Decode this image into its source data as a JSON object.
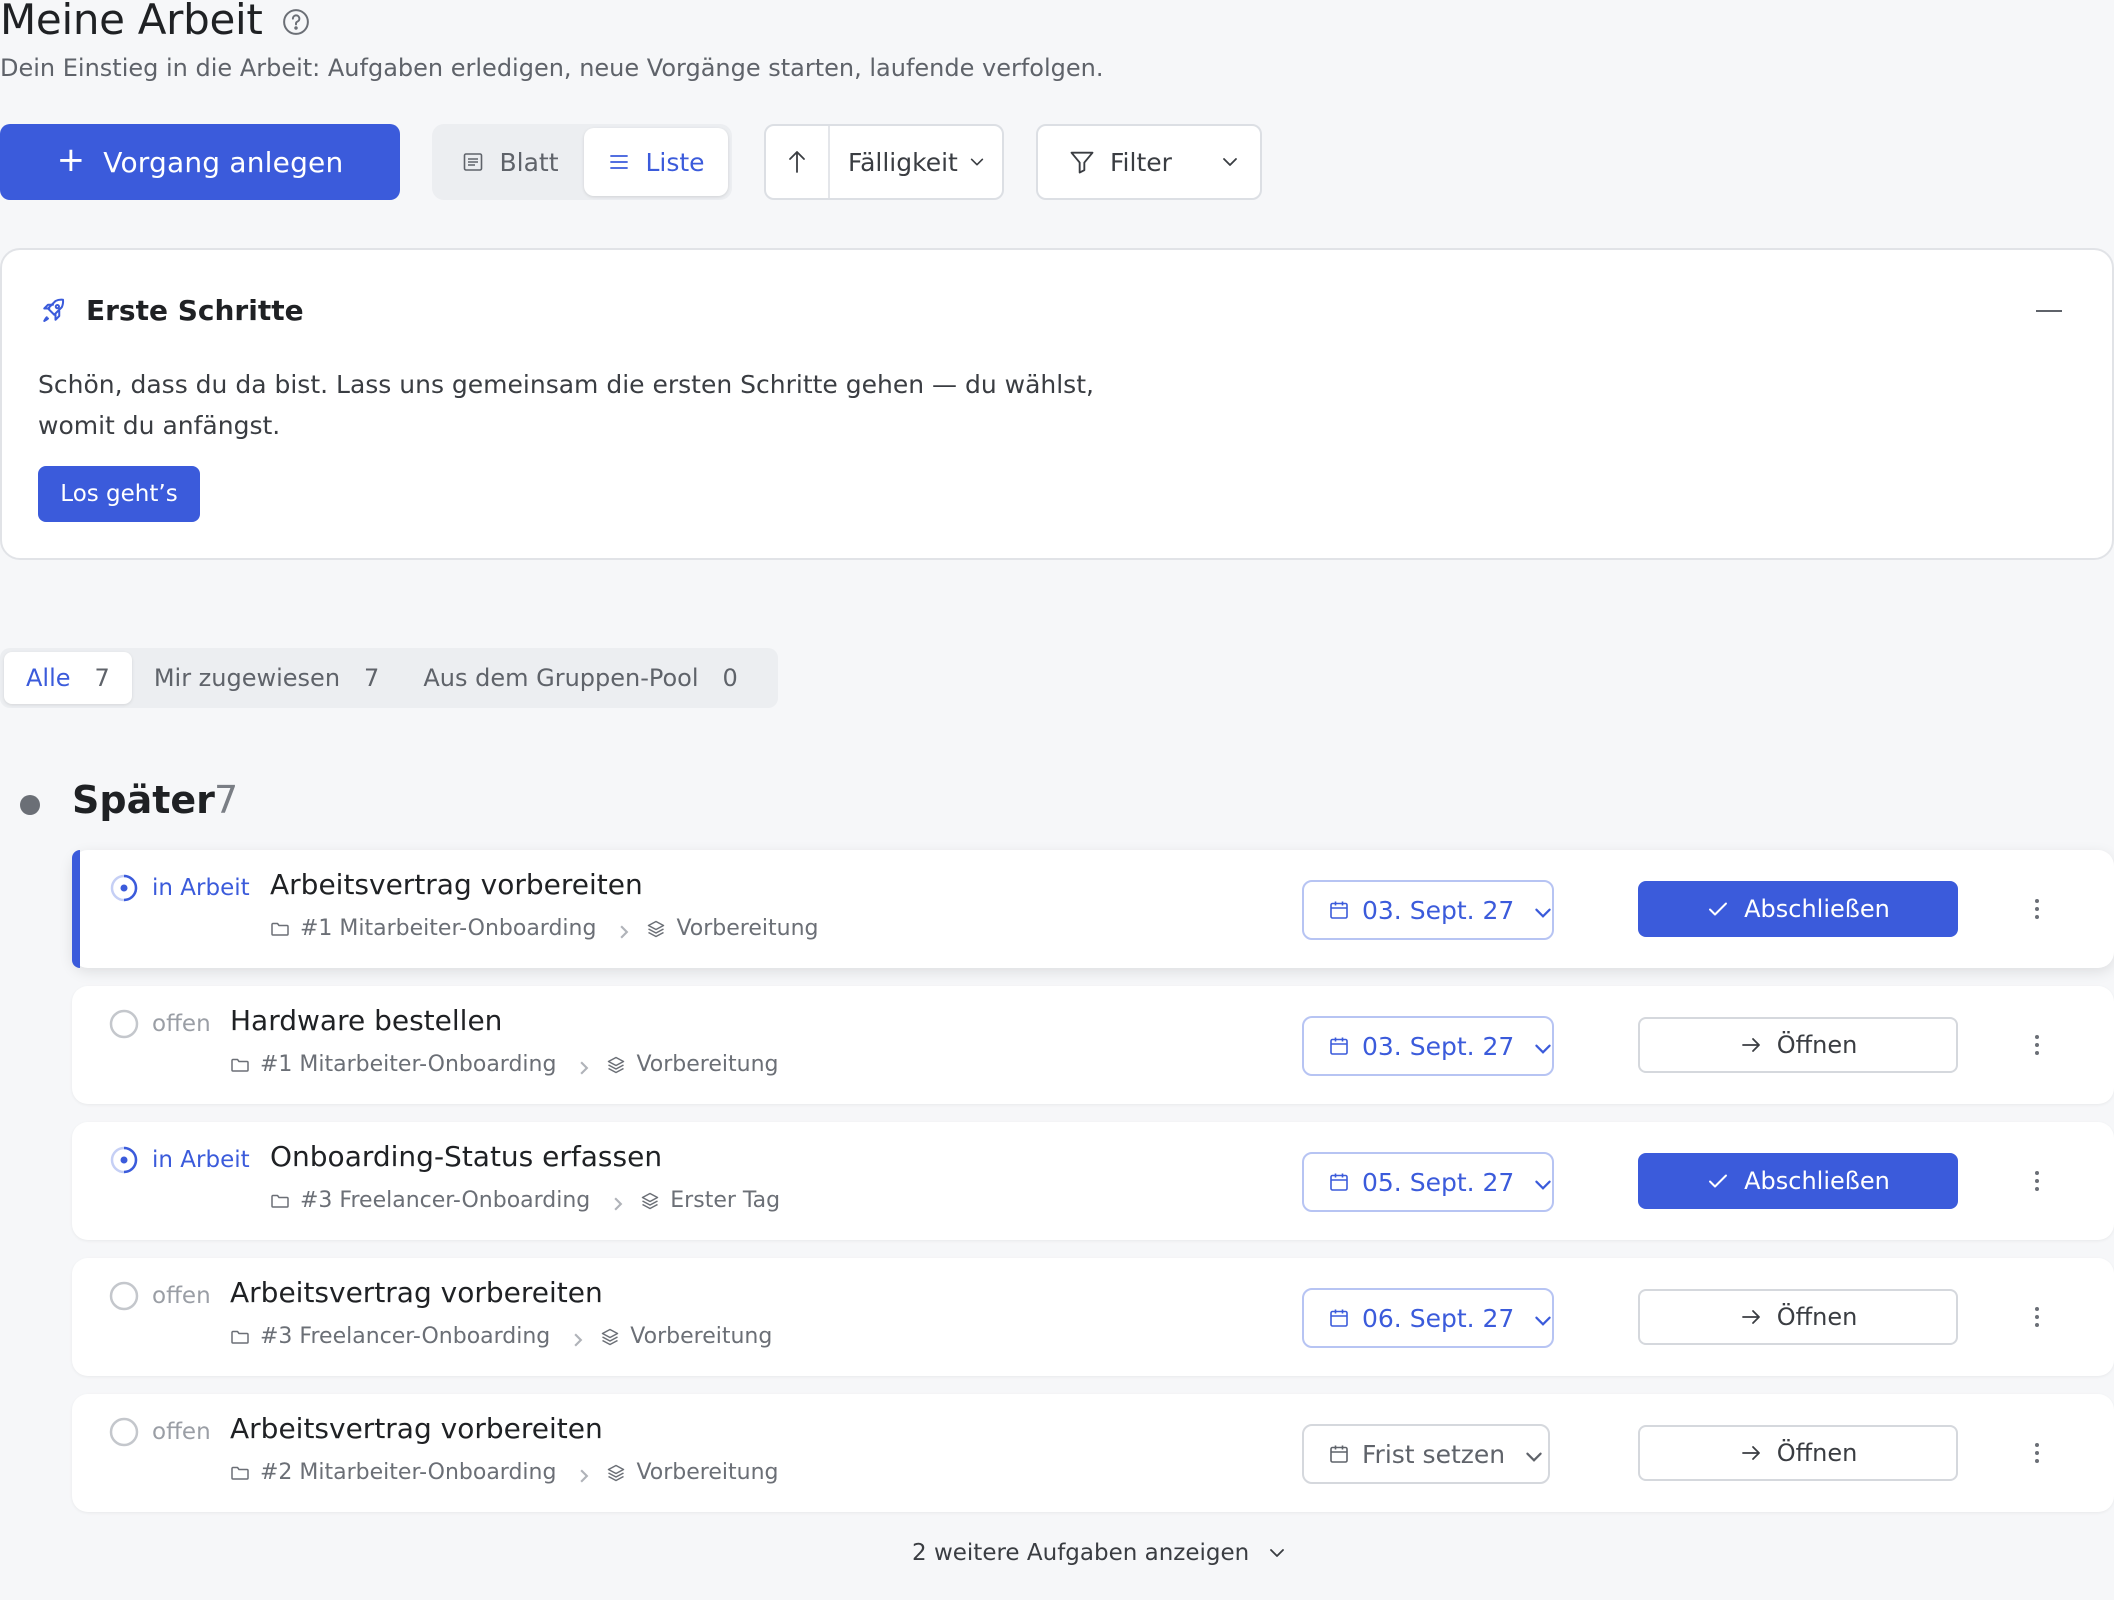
{
  "header": {
    "title": "Meine Arbeit",
    "subtitle": "Dein Einstieg in die Arbeit: Aufgaben erledigen, neue Vorgänge starten, laufende verfolgen."
  },
  "toolbar": {
    "create_label": "Vorgang anlegen",
    "view_blatt": "Blatt",
    "view_liste": "Liste",
    "active_view": "Liste",
    "sort_label": "Fälligkeit",
    "filter_label": "Filter"
  },
  "onboarding": {
    "title": "Erste Schritte",
    "text": "Schön, dass du da bist. Lass uns gemeinsam die ersten Schritte gehen — du wählst, womit du anfängst.",
    "button_label": "Los geht’s"
  },
  "scope_tabs": [
    {
      "label": "Alle",
      "count": "7",
      "active": true
    },
    {
      "label": "Mir zugewiesen",
      "count": "7",
      "active": false
    },
    {
      "label": "Aus dem Gruppen-Pool",
      "count": "0",
      "active": false
    }
  ],
  "group": {
    "title": "Später",
    "count": "7"
  },
  "tasks": [
    {
      "status": "in Arbeit",
      "title": "Arbeitsvertrag vorbereiten",
      "process": "#1 Mitarbeiter-Onboarding",
      "phase": "Vorbereitung",
      "due": "03. Sept. 27",
      "action": "Abschließen"
    },
    {
      "status": "offen",
      "title": "Hardware bestellen",
      "process": "#1 Mitarbeiter-Onboarding",
      "phase": "Vorbereitung",
      "due": "03. Sept. 27",
      "action": "Öffnen"
    },
    {
      "status": "in Arbeit",
      "title": "Onboarding-Status erfassen",
      "process": "#3 Freelancer-Onboarding",
      "phase": "Erster Tag",
      "due": "05. Sept. 27",
      "action": "Abschließen"
    },
    {
      "status": "offen",
      "title": "Arbeitsvertrag vorbereiten",
      "process": "#3 Freelancer-Onboarding",
      "phase": "Vorbereitung",
      "due": "06. Sept. 27",
      "action": "Öffnen"
    },
    {
      "status": "offen",
      "title": "Arbeitsvertrag vorbereiten",
      "process": "#2 Mitarbeiter-Onboarding",
      "phase": "Vorbereitung",
      "due": "Frist setzen",
      "action": "Öffnen"
    }
  ],
  "show_more_label": "2 weitere Aufgaben anzeigen",
  "colors": {
    "accent": "#3b5bdb",
    "background": "#f6f7f9",
    "muted": "#6b6f76"
  },
  "icons": [
    "help-icon",
    "list-icon",
    "document-icon",
    "arrow-up-icon",
    "chevron-down-icon",
    "filter-icon",
    "rocket-icon",
    "collapse-icon",
    "in-progress-icon",
    "open-circle-icon",
    "folder-icon",
    "layers-icon",
    "calendar-icon",
    "check-icon",
    "arrow-right-icon",
    "more-vertical-icon"
  ]
}
